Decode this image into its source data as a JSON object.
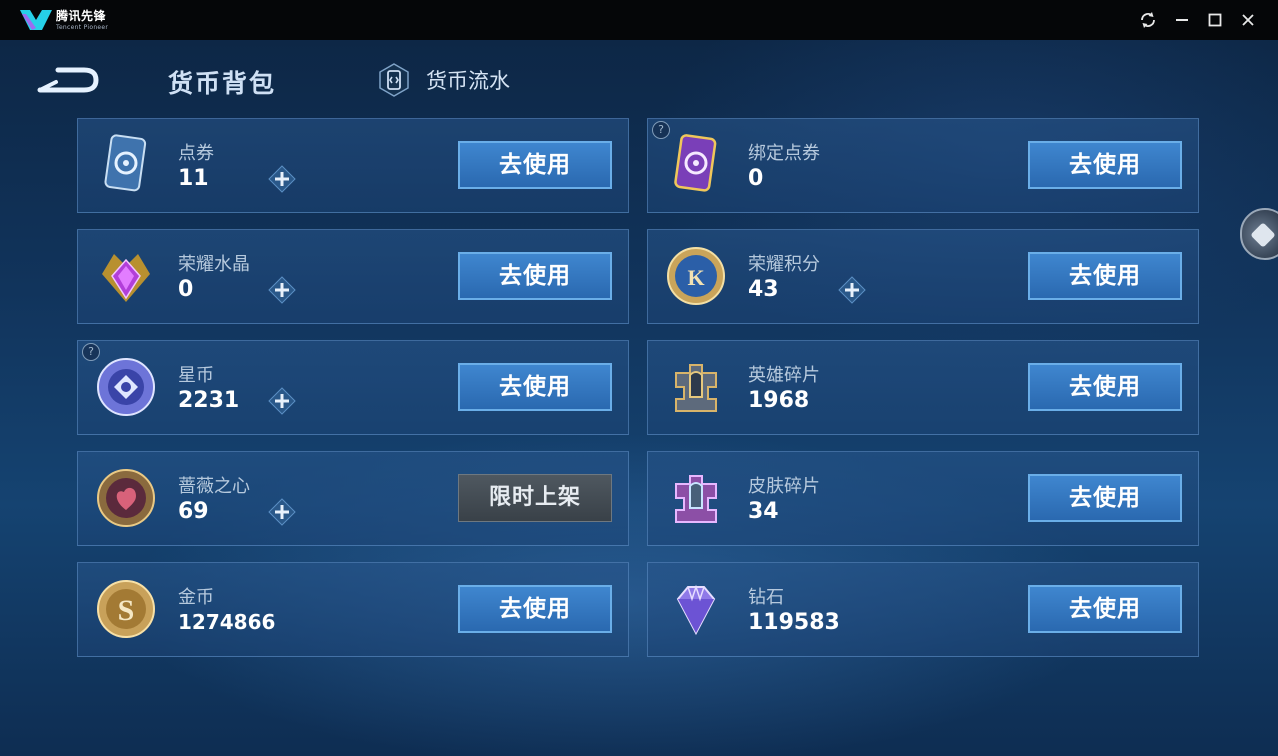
{
  "window": {
    "app_name": "腾讯先锋",
    "app_subtitle": "Tencent Pioneer",
    "controls": [
      "refresh-icon",
      "minimize-icon",
      "maximize-icon",
      "close-icon"
    ]
  },
  "header": {
    "title": "货币背包",
    "flow_tab": "货币流水"
  },
  "colors": {
    "background": "#11345c",
    "use_button": "#2f74bd",
    "limited_button": "#454d55"
  },
  "currencies": [
    {
      "name": "点券",
      "amount": "11",
      "button": "去使用",
      "icon": "coupon-card-icon",
      "has_plus": true,
      "has_help": false
    },
    {
      "name": "绑定点券",
      "amount": "0",
      "button": "去使用",
      "icon": "bound-coupon-card-icon",
      "has_plus": false,
      "has_help": true
    },
    {
      "name": "荣耀水晶",
      "amount": "0",
      "button": "去使用",
      "icon": "glory-crystal-icon",
      "has_plus": true,
      "has_help": false
    },
    {
      "name": "荣耀积分",
      "amount": "43",
      "button": "去使用",
      "icon": "glory-points-icon",
      "has_plus": true,
      "has_help": false
    },
    {
      "name": "星币",
      "amount": "2231",
      "button": "去使用",
      "icon": "star-coin-icon",
      "has_plus": true,
      "has_help": true
    },
    {
      "name": "英雄碎片",
      "amount": "1968",
      "button": "去使用",
      "icon": "hero-fragment-icon",
      "has_plus": false,
      "has_help": false
    },
    {
      "name": "蔷薇之心",
      "amount": "69",
      "button": "限时上架",
      "icon": "rose-heart-icon",
      "has_plus": true,
      "has_help": false
    },
    {
      "name": "皮肤碎片",
      "amount": "34",
      "button": "去使用",
      "icon": "skin-fragment-icon",
      "has_plus": false,
      "has_help": false
    },
    {
      "name": "金币",
      "amount": "1274866",
      "button": "去使用",
      "icon": "gold-coin-icon",
      "has_plus": false,
      "has_help": false
    },
    {
      "name": "钻石",
      "amount": "119583",
      "button": "去使用",
      "icon": "diamond-icon",
      "has_plus": false,
      "has_help": false
    }
  ]
}
